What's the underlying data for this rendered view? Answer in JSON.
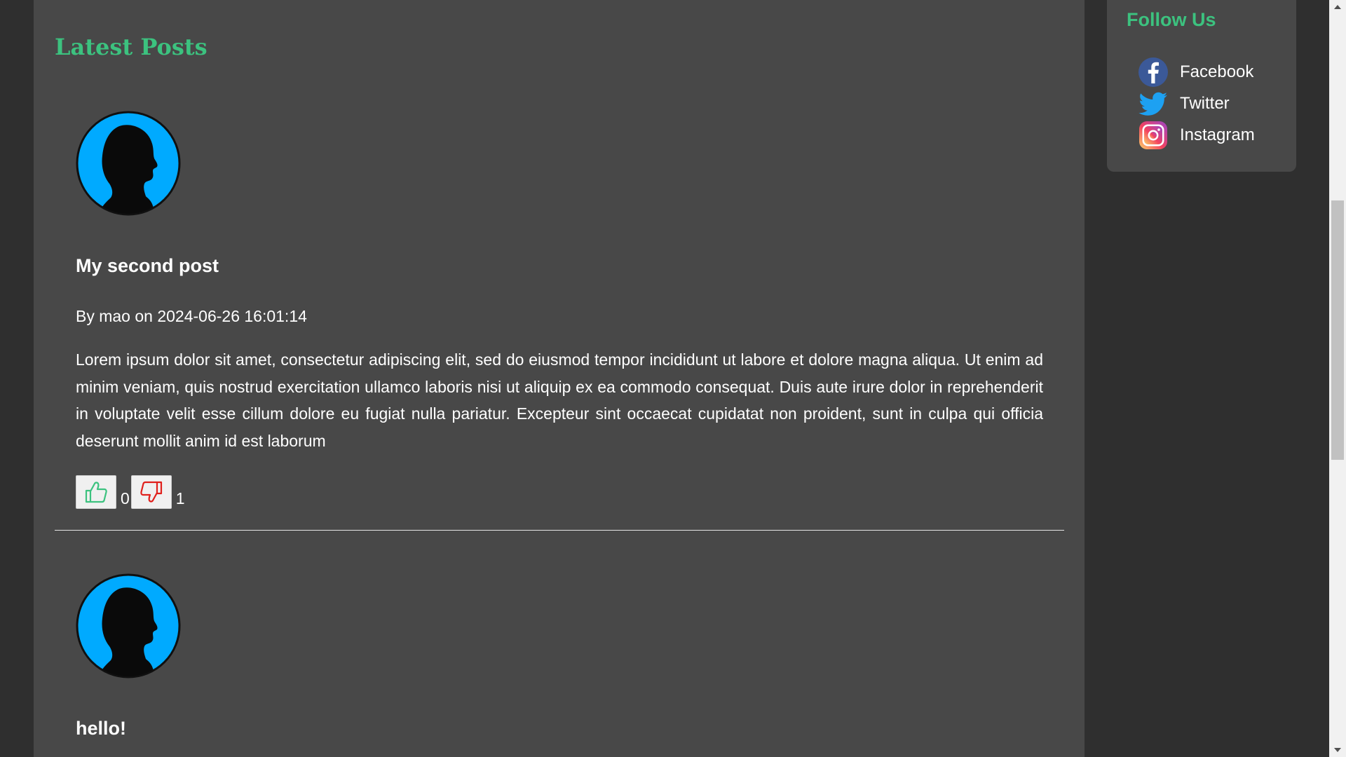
{
  "main": {
    "section_title": "Latest Posts",
    "posts": [
      {
        "title": "My second post",
        "meta": "By mao on 2024-06-26 16:01:14",
        "body": "Lorem ipsum dolor sit amet, consectetur adipiscing elit, sed do eiusmod tempor incididunt ut labore et dolore magna aliqua. Ut enim ad minim veniam, quis nostrud exercitation ullamco laboris nisi ut aliquip ex ea commodo consequat. Duis aute irure dolor in reprehenderit in voluptate velit esse cillum dolore eu fugiat nulla pariatur. Excepteur sint occaecat cupidatat non proident, sunt in culpa qui officia deserunt mollit anim id est laborum",
        "likes": "0",
        "dislikes": "1"
      },
      {
        "title": "hello!"
      }
    ]
  },
  "sidebar": {
    "title": "Follow Us",
    "social": [
      {
        "label": "Facebook",
        "icon": "facebook-icon"
      },
      {
        "label": "Twitter",
        "icon": "twitter-icon"
      },
      {
        "label": "Instagram",
        "icon": "instagram-icon"
      }
    ]
  },
  "colors": {
    "accent": "#3cc27f",
    "panel": "#484848",
    "page_bg": "#2f2f2f",
    "avatar_blue": "#00aaff",
    "like_green": "#3cc27f",
    "dislike_red": "#e0201c"
  }
}
